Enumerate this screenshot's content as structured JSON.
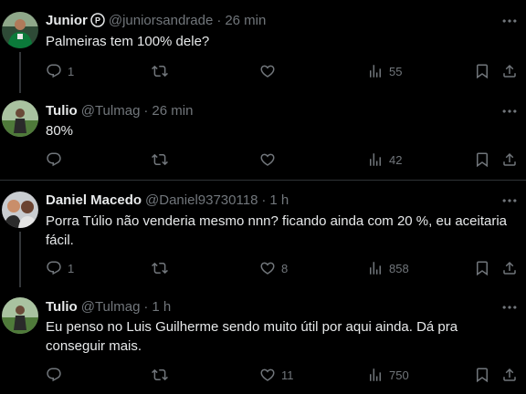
{
  "tweets": [
    {
      "name": "Junior",
      "handle": "@juniorsandrade",
      "sep": "·",
      "time": "26 min",
      "text": "Palmeiras tem 100% dele?",
      "replies": "1",
      "retweets": "",
      "likes": "",
      "views": "55"
    },
    {
      "name": "Tulio",
      "handle": "@Tulmag",
      "sep": "·",
      "time": "26 min",
      "text": "80%",
      "replies": "",
      "retweets": "",
      "likes": "",
      "views": "42"
    },
    {
      "name": "Daniel Macedo",
      "handle": "@Daniel93730118",
      "sep": "·",
      "time": "1 h",
      "text": "Porra Túlio não venderia mesmo nnn? ficando ainda com 20 %, eu aceitaria fácil.",
      "replies": "1",
      "retweets": "",
      "likes": "8",
      "views": "858"
    },
    {
      "name": "Tulio",
      "handle": "@Tulmag",
      "sep": "·",
      "time": "1 h",
      "text": "Eu penso no Luis Guilherme sendo muito útil por aqui ainda. Dá pra conseguir mais.",
      "replies": "",
      "retweets": "",
      "likes": "11",
      "views": "750"
    }
  ],
  "colors": {
    "background": "#000000",
    "text": "#e7e9ea",
    "muted": "#71767b",
    "divider": "#2f3336"
  },
  "icons": {
    "reply": "speech-bubble-icon",
    "retweet": "retweet-arrows-icon",
    "like": "heart-icon",
    "views": "bar-chart-icon",
    "bookmark": "bookmark-icon",
    "share": "share-upload-icon",
    "more": "more-horizontal-icon",
    "badge": "palmeiras-badge-icon"
  }
}
